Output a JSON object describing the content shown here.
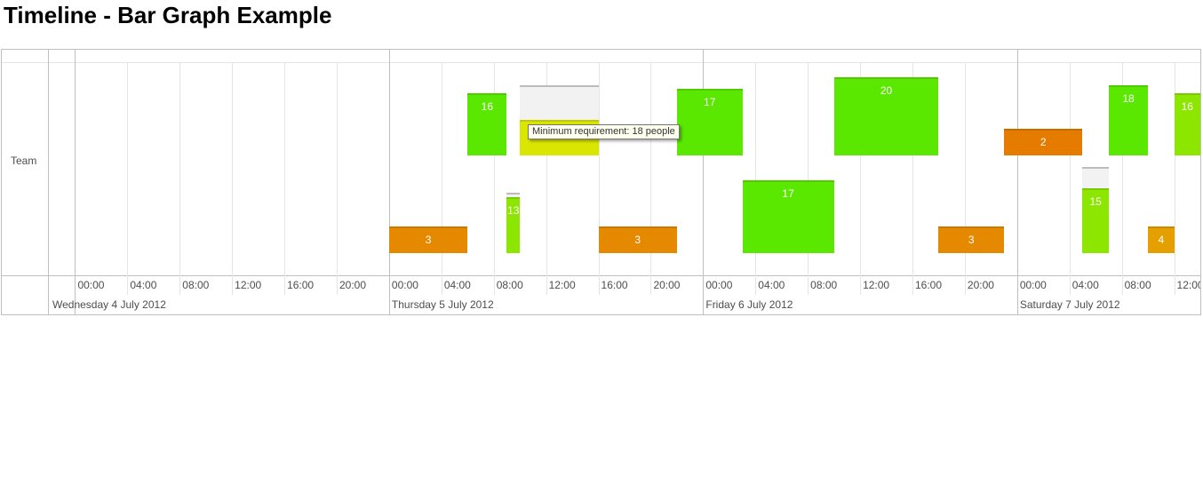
{
  "page": {
    "title": "Timeline - Bar Graph Example"
  },
  "timeline": {
    "group_label": "Team",
    "hour_ticks": [
      "00:00",
      "04:00",
      "08:00",
      "12:00",
      "16:00",
      "20:00",
      "00:00",
      "04:00",
      "08:00",
      "12:00",
      "16:00",
      "20:00",
      "00:00",
      "04:00",
      "08:00",
      "12:00",
      "16:00",
      "20:00",
      "00:00",
      "04:00",
      "08:00",
      "12:00"
    ],
    "day_labels": [
      "Wednesday 4 July 2012",
      "Thursday 5 July 2012",
      "Friday 6 July 2012",
      "Saturday 7 July 2012"
    ],
    "tooltip": "Minimum requirement: 18 people",
    "colors": {
      "green": "#5ae800",
      "light_green": "#8ce600",
      "yellow": "#dbe600",
      "orange": "#e58a00",
      "dark_orange": "#e57c00",
      "requirement_fill": "#f2f2f2",
      "grid": "#e5e5e5",
      "border": "#bfbfbf"
    }
  },
  "chart_data": {
    "type": "bar",
    "group": "Team",
    "x_unit": "date-time",
    "x_range": [
      "2012-07-03 22:00",
      "2012-07-07 14:00"
    ],
    "bars": [
      {
        "row": "top",
        "start": "2012-07-05 06:00",
        "end": "2012-07-05 09:00",
        "value": 16,
        "color": "#5ae800"
      },
      {
        "row": "top",
        "start": "2012-07-05 10:00",
        "end": "2012-07-05 16:00",
        "value": 9,
        "requirement": 18,
        "color": "#dbe600"
      },
      {
        "row": "top",
        "start": "2012-07-05 22:00",
        "end": "2012-07-06 03:00",
        "value": 17,
        "color": "#5ae800"
      },
      {
        "row": "top",
        "start": "2012-07-06 10:00",
        "end": "2012-07-06 18:00",
        "value": 20,
        "color": "#5ae800"
      },
      {
        "row": "top",
        "start": "2012-07-06 23:00",
        "end": "2012-07-07 05:00",
        "value": 2,
        "requirement": 4,
        "color": "#e57c00"
      },
      {
        "row": "top",
        "start": "2012-07-07 07:00",
        "end": "2012-07-07 10:00",
        "value": 18,
        "color": "#5ae800"
      },
      {
        "row": "top",
        "start": "2012-07-07 12:00",
        "end": "2012-07-07 14:00",
        "value": 16,
        "color": "#8ce600"
      },
      {
        "row": "bottom",
        "start": "2012-07-05 00:00",
        "end": "2012-07-05 06:00",
        "value": 3,
        "requirement": 4,
        "color": "#e58a00"
      },
      {
        "row": "bottom",
        "start": "2012-07-05 09:00",
        "end": "2012-07-05 10:00",
        "value": 13,
        "requirement": 14,
        "color": "#8ce600"
      },
      {
        "row": "bottom",
        "start": "2012-07-05 16:00",
        "end": "2012-07-05 22:00",
        "value": 3,
        "requirement": 4,
        "color": "#e58a00"
      },
      {
        "row": "bottom",
        "start": "2012-07-06 03:00",
        "end": "2012-07-06 10:00",
        "value": 17,
        "color": "#5ae800"
      },
      {
        "row": "bottom",
        "start": "2012-07-06 18:00",
        "end": "2012-07-06 23:00",
        "value": 3,
        "requirement": 3.3,
        "color": "#e58a00"
      },
      {
        "row": "bottom",
        "start": "2012-07-07 05:00",
        "end": "2012-07-07 07:00",
        "value": 15,
        "requirement": 20,
        "color": "#8ce600"
      },
      {
        "row": "bottom",
        "start": "2012-07-07 10:00",
        "end": "2012-07-07 12:00",
        "value": 4,
        "color": "#e5a000"
      }
    ]
  }
}
